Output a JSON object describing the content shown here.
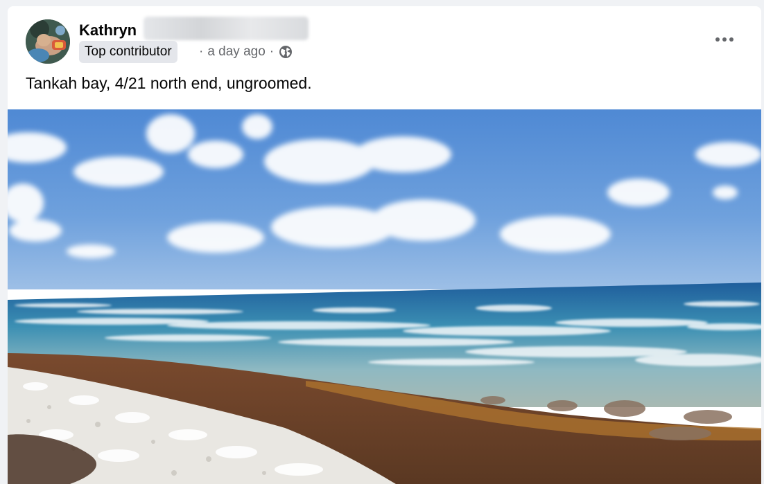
{
  "post": {
    "author_name": "Kathryn",
    "badge": "Top contributor",
    "separator": "·",
    "timestamp": "a day ago",
    "audience_icon": "globe-icon",
    "more_icon": "more-options-icon",
    "text": "Tankah bay, 4/21 north end, ungroomed."
  },
  "colors": {
    "page_bg": "#f0f2f5",
    "card_bg": "#ffffff",
    "badge_bg": "#e4e6eb",
    "secondary_text": "#65676b",
    "primary_text": "#050505"
  }
}
